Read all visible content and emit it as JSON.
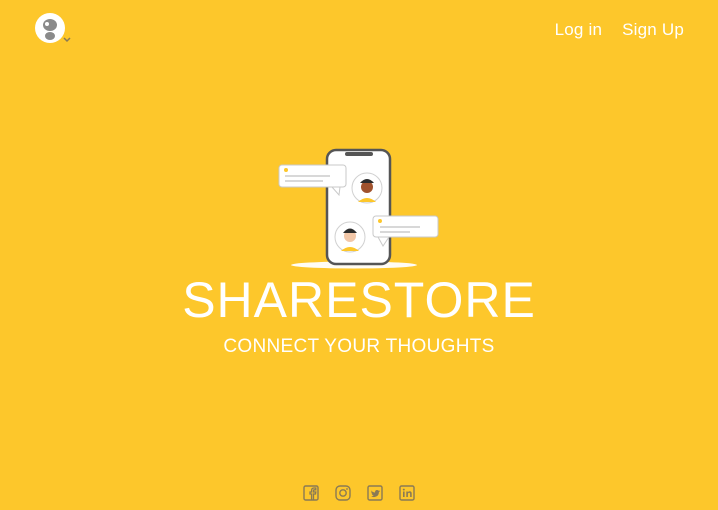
{
  "header": {
    "logo_icon": "owl-logo-icon",
    "login_label": "Log in",
    "signup_label": "Sign Up"
  },
  "hero": {
    "title": "SHARESTORE",
    "tagline": "CONNECT YOUR THOUGHTS",
    "illustration": "phone-chat-illustration"
  },
  "footer": {
    "social_icons": [
      "facebook-icon",
      "instagram-icon",
      "twitter-icon",
      "linkedin-icon"
    ]
  },
  "colors": {
    "background": "#FDC72B",
    "text": "#FFFFFF",
    "icon": "#8A7A55"
  }
}
